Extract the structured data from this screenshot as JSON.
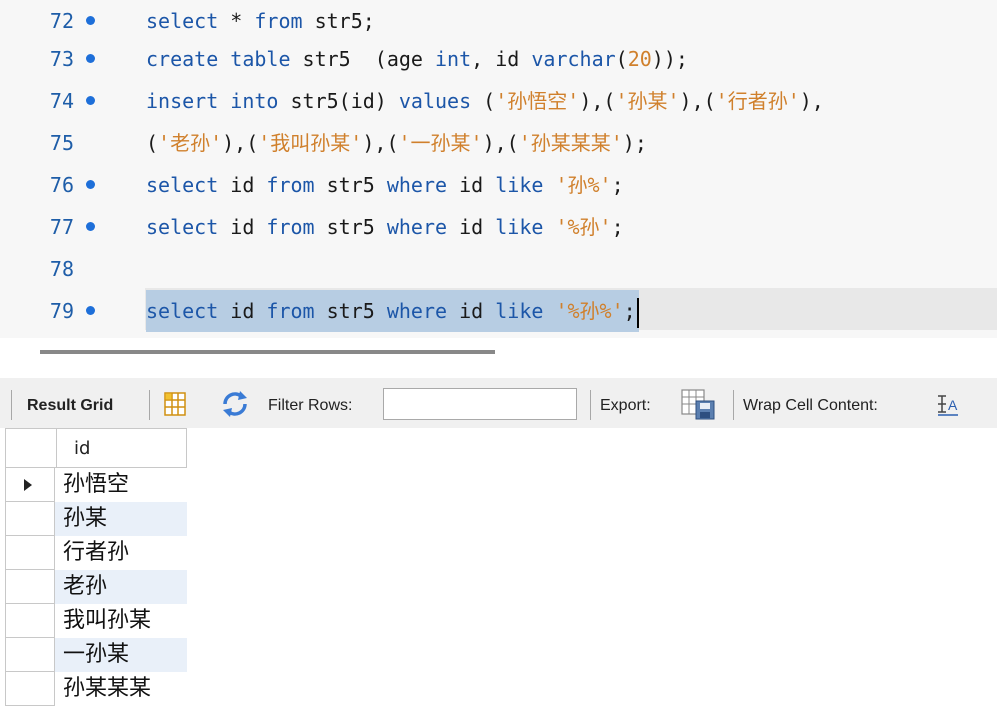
{
  "editor": {
    "lines": [
      {
        "num": "72",
        "dot": true
      },
      {
        "num": "73",
        "dot": true
      },
      {
        "num": "74",
        "dot": true
      },
      {
        "num": "75",
        "dot": false
      },
      {
        "num": "76",
        "dot": true
      },
      {
        "num": "77",
        "dot": true
      },
      {
        "num": "78",
        "dot": false
      },
      {
        "num": "79",
        "dot": true
      }
    ],
    "tokens": {
      "l72": [
        "select",
        " * ",
        "from",
        " str5;"
      ],
      "l73": [
        "create",
        " ",
        "table",
        " str5  (age ",
        "int",
        ", id ",
        "varchar",
        "(",
        "20",
        "));"
      ],
      "l74": [
        "insert",
        " ",
        "into",
        " str5(id) ",
        "values",
        " (",
        "'孙悟空'",
        "),(",
        "'孙某'",
        "),(",
        "'行者孙'",
        "),"
      ],
      "l75": [
        "(",
        "'老孙'",
        "),(",
        "'我叫孙某'",
        "),(",
        "'一孙某'",
        "),(",
        "'孙某某某'",
        ");"
      ],
      "l76": [
        "select",
        " id ",
        "from",
        " str5 ",
        "where",
        " id ",
        "like",
        " ",
        "'孙%'",
        ";"
      ],
      "l77": [
        "select",
        " id ",
        "from",
        " str5 ",
        "where",
        " id ",
        "like",
        " ",
        "'%孙'",
        ";"
      ],
      "l79": [
        "select",
        " id ",
        "from",
        " str5 ",
        "where",
        " id ",
        "like",
        " ",
        "'%孙%'",
        ";"
      ]
    }
  },
  "toolbar": {
    "result_grid": "Result Grid",
    "filter_rows": "Filter Rows:",
    "filter_value": "",
    "export": "Export:",
    "wrap_cell": "Wrap Cell Content:",
    "wrap_icon": "wrap-text-icon",
    "grid_icon": "grid-view-icon",
    "refresh_icon": "refresh-icon",
    "export_icon": "export-icon"
  },
  "grid": {
    "columns": [
      "id"
    ],
    "rows": [
      "孙悟空",
      "孙某",
      "行者孙",
      "老孙",
      "我叫孙某",
      "一孙某",
      "孙某某某"
    ]
  },
  "colors": {
    "keyword": "#1c56a8",
    "string": "#d0802c",
    "selection": "#b7cde3"
  }
}
